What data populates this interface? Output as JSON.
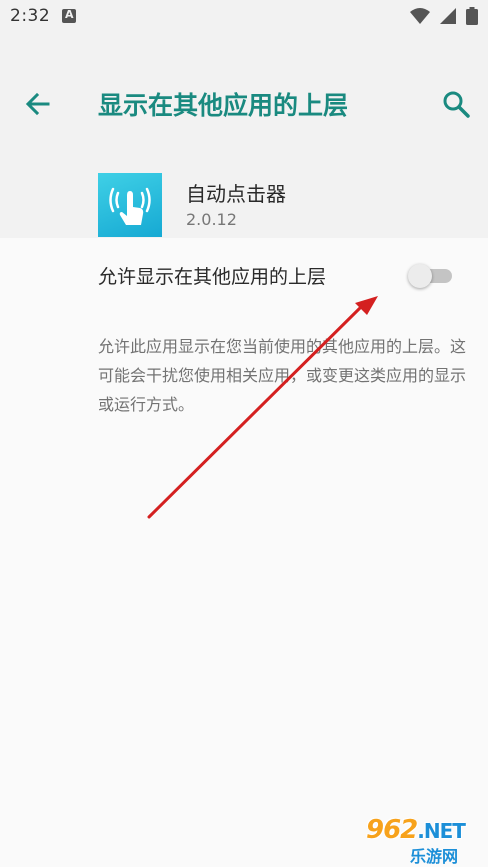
{
  "status_bar": {
    "time": "2:32",
    "notification_icon": "accessibility-a-icon",
    "wifi_icon": "wifi-icon",
    "signal_icon": "cell-signal-icon",
    "battery_icon": "battery-icon"
  },
  "header": {
    "title": "显示在其他应用的上层",
    "back_icon": "arrow-back-icon",
    "search_icon": "search-icon",
    "accent_color": "#1a8a80"
  },
  "app": {
    "name": "自动点击器",
    "version": "2.0.12",
    "icon": "tap-hand-icon"
  },
  "setting": {
    "label": "允许显示在其他应用的上层",
    "toggle_on": false,
    "description": "允许此应用显示在您当前使用的其他应用的上层。这可能会干扰您使用相关应用，或变更这类应用的显示或运行方式。"
  },
  "annotation": {
    "arrow_color": "#d42020"
  },
  "watermark": {
    "logo": "962",
    "logo_suffix": ".NET",
    "sub": "乐游网"
  }
}
